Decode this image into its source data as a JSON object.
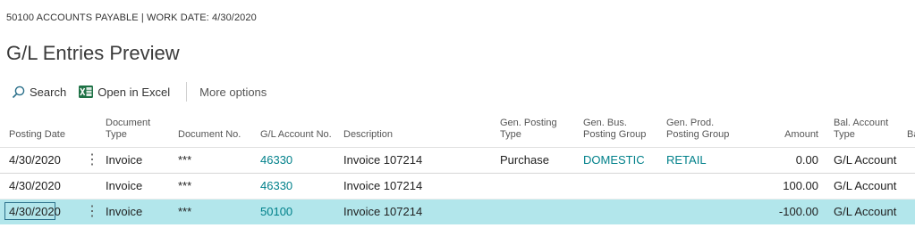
{
  "header": {
    "context": "50100 ACCOUNTS PAYABLE | WORK DATE: 4/30/2020",
    "title": "G/L Entries Preview"
  },
  "actions": {
    "search": "Search",
    "open_excel": "Open in Excel",
    "more": "More options"
  },
  "columns": {
    "posting_date": "Posting Date",
    "document_type": "Document\nType",
    "document_no": "Document No.",
    "gl_account_no": "G/L Account No.",
    "description": "Description",
    "gen_posting_type": "Gen. Posting\nType",
    "gen_bus_posting_group": "Gen. Bus.\nPosting Group",
    "gen_prod_posting_group": "Gen. Prod.\nPosting Group",
    "amount": "Amount",
    "bal_account_type": "Bal. Account\nType",
    "bal_cut": "Ba"
  },
  "rows": [
    {
      "posting_date": "4/30/2020",
      "menu": "⋮",
      "document_type": "Invoice",
      "document_no": "***",
      "gl_account_no": "46330",
      "description": "Invoice 107214",
      "gen_posting_type": "Purchase",
      "gen_bus_posting_group": "DOMESTIC",
      "gen_prod_posting_group": "RETAIL",
      "amount": "0.00",
      "bal_account_type": "G/L Account"
    },
    {
      "posting_date": "4/30/2020",
      "menu": "",
      "document_type": "Invoice",
      "document_no": "***",
      "gl_account_no": "46330",
      "description": "Invoice 107214",
      "gen_posting_type": "",
      "gen_bus_posting_group": "",
      "gen_prod_posting_group": "",
      "amount": "100.00",
      "bal_account_type": "G/L Account"
    },
    {
      "posting_date": "4/30/2020",
      "menu": "⋮",
      "document_type": "Invoice",
      "document_no": "***",
      "gl_account_no": "50100",
      "description": "Invoice 107214",
      "gen_posting_type": "",
      "gen_bus_posting_group": "",
      "gen_prod_posting_group": "",
      "amount": "-100.00",
      "bal_account_type": "G/L Account"
    }
  ],
  "colors": {
    "link": "#00808a",
    "selected_row": "#b2e6eb",
    "excel_green": "#1e7145"
  }
}
